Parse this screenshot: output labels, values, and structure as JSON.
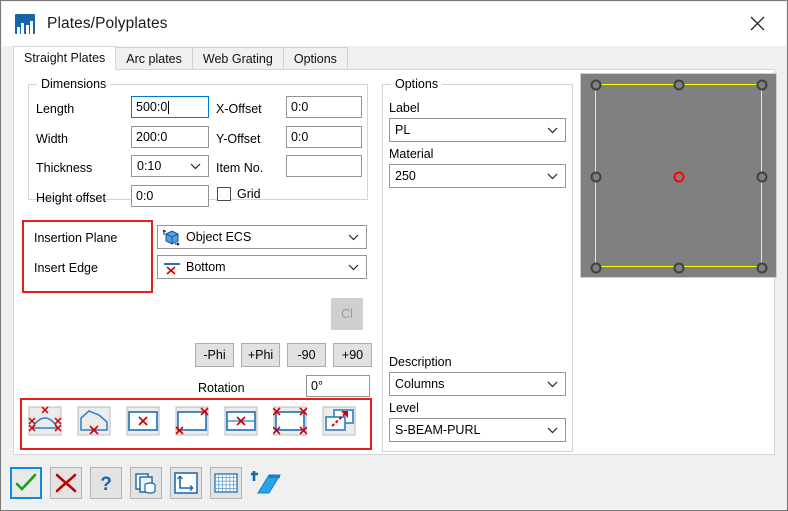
{
  "window": {
    "title": "Plates/Polyplates",
    "app_icon": "building-icon",
    "close_icon": "close-icon"
  },
  "tabs": [
    {
      "label": "Straight Plates",
      "active": true
    },
    {
      "label": "Arc plates",
      "active": false
    },
    {
      "label": "Web Grating",
      "active": false
    },
    {
      "label": "Options",
      "active": false
    }
  ],
  "dimensions": {
    "title": "Dimensions",
    "length_label": "Length",
    "length_value": "500:0",
    "width_label": "Width",
    "width_value": "200:0",
    "thickness_label": "Thickness",
    "thickness_value": "0:10",
    "height_offset_label": "Height offset",
    "height_offset_value": "0:0",
    "x_offset_label": "X-Offset",
    "x_offset_value": "0:0",
    "y_offset_label": "Y-Offset",
    "y_offset_value": "0:0",
    "item_no_label": "Item No.",
    "item_no_value": "",
    "grid_label": "Grid",
    "grid_checked": false
  },
  "insertion": {
    "plane_label": "Insertion Plane",
    "plane_value": "Object ECS",
    "plane_icon": "object-ecs-icon",
    "edge_label": "Insert Edge",
    "edge_value": "Bottom",
    "edge_icon": "bottom-edge-icon"
  },
  "rotation": {
    "cl_label": "Cl",
    "minus_phi_label": "-Phi",
    "plus_phi_label": "+Phi",
    "minus_90_label": "-90",
    "plus_90_label": "+90",
    "rotation_label": "Rotation",
    "rotation_value": "0°"
  },
  "insert_modes": [
    {
      "name": "arc-plate-corners-icon"
    },
    {
      "name": "polyplate-bottom-point-icon"
    },
    {
      "name": "plate-center-point-icon"
    },
    {
      "name": "plate-corner-points-icon"
    },
    {
      "name": "plate-midline-point-icon"
    },
    {
      "name": "plate-four-corners-icon"
    },
    {
      "name": "plate-copy-arrow-icon"
    }
  ],
  "options": {
    "title": "Options",
    "label_label": "Label",
    "label_value": "PL",
    "material_label": "Material",
    "material_value": "250",
    "description_label": "Description",
    "description_value": "Columns",
    "level_label": "Level",
    "level_value": "S-BEAM-PURL"
  },
  "preview": {
    "plate_outline_color": "#ffff00",
    "background_color": "#808080",
    "center_marker_color": "#ff0000"
  },
  "toolbar": [
    {
      "name": "apply-ok-icon",
      "selected": true
    },
    {
      "name": "cancel-x-icon",
      "selected": false
    },
    {
      "name": "help-question-icon",
      "selected": false
    },
    {
      "name": "copy-properties-icon",
      "selected": false
    },
    {
      "name": "ucs-axes-icon",
      "selected": false
    },
    {
      "name": "grid-table-icon",
      "selected": false
    },
    {
      "name": "3d-plate-icon",
      "selected": false
    }
  ]
}
